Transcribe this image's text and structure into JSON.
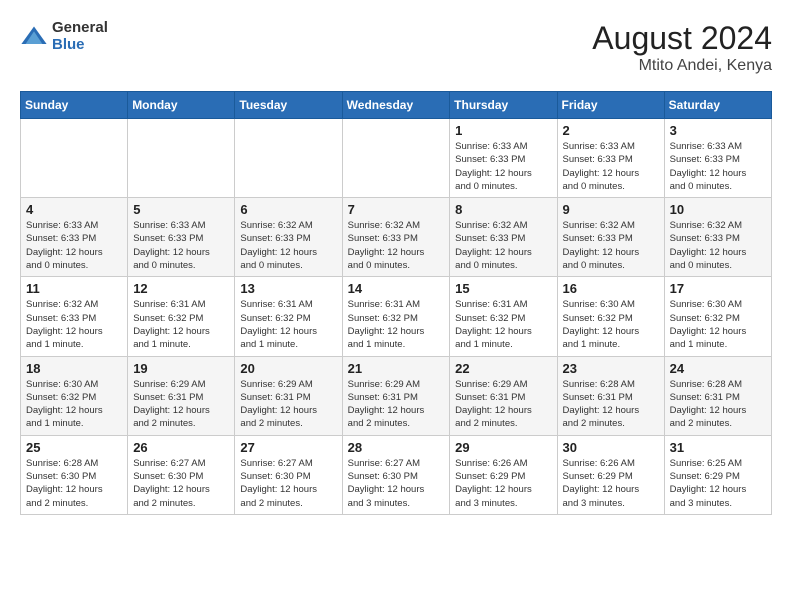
{
  "logo": {
    "general": "General",
    "blue": "Blue"
  },
  "title": {
    "month_year": "August 2024",
    "location": "Mtito Andei, Kenya"
  },
  "weekdays": [
    "Sunday",
    "Monday",
    "Tuesday",
    "Wednesday",
    "Thursday",
    "Friday",
    "Saturday"
  ],
  "weeks": [
    [
      {
        "day": "",
        "info": ""
      },
      {
        "day": "",
        "info": ""
      },
      {
        "day": "",
        "info": ""
      },
      {
        "day": "",
        "info": ""
      },
      {
        "day": "1",
        "info": "Sunrise: 6:33 AM\nSunset: 6:33 PM\nDaylight: 12 hours\nand 0 minutes."
      },
      {
        "day": "2",
        "info": "Sunrise: 6:33 AM\nSunset: 6:33 PM\nDaylight: 12 hours\nand 0 minutes."
      },
      {
        "day": "3",
        "info": "Sunrise: 6:33 AM\nSunset: 6:33 PM\nDaylight: 12 hours\nand 0 minutes."
      }
    ],
    [
      {
        "day": "4",
        "info": "Sunrise: 6:33 AM\nSunset: 6:33 PM\nDaylight: 12 hours\nand 0 minutes."
      },
      {
        "day": "5",
        "info": "Sunrise: 6:33 AM\nSunset: 6:33 PM\nDaylight: 12 hours\nand 0 minutes."
      },
      {
        "day": "6",
        "info": "Sunrise: 6:32 AM\nSunset: 6:33 PM\nDaylight: 12 hours\nand 0 minutes."
      },
      {
        "day": "7",
        "info": "Sunrise: 6:32 AM\nSunset: 6:33 PM\nDaylight: 12 hours\nand 0 minutes."
      },
      {
        "day": "8",
        "info": "Sunrise: 6:32 AM\nSunset: 6:33 PM\nDaylight: 12 hours\nand 0 minutes."
      },
      {
        "day": "9",
        "info": "Sunrise: 6:32 AM\nSunset: 6:33 PM\nDaylight: 12 hours\nand 0 minutes."
      },
      {
        "day": "10",
        "info": "Sunrise: 6:32 AM\nSunset: 6:33 PM\nDaylight: 12 hours\nand 0 minutes."
      }
    ],
    [
      {
        "day": "11",
        "info": "Sunrise: 6:32 AM\nSunset: 6:33 PM\nDaylight: 12 hours\nand 1 minute."
      },
      {
        "day": "12",
        "info": "Sunrise: 6:31 AM\nSunset: 6:32 PM\nDaylight: 12 hours\nand 1 minute."
      },
      {
        "day": "13",
        "info": "Sunrise: 6:31 AM\nSunset: 6:32 PM\nDaylight: 12 hours\nand 1 minute."
      },
      {
        "day": "14",
        "info": "Sunrise: 6:31 AM\nSunset: 6:32 PM\nDaylight: 12 hours\nand 1 minute."
      },
      {
        "day": "15",
        "info": "Sunrise: 6:31 AM\nSunset: 6:32 PM\nDaylight: 12 hours\nand 1 minute."
      },
      {
        "day": "16",
        "info": "Sunrise: 6:30 AM\nSunset: 6:32 PM\nDaylight: 12 hours\nand 1 minute."
      },
      {
        "day": "17",
        "info": "Sunrise: 6:30 AM\nSunset: 6:32 PM\nDaylight: 12 hours\nand 1 minute."
      }
    ],
    [
      {
        "day": "18",
        "info": "Sunrise: 6:30 AM\nSunset: 6:32 PM\nDaylight: 12 hours\nand 1 minute."
      },
      {
        "day": "19",
        "info": "Sunrise: 6:29 AM\nSunset: 6:31 PM\nDaylight: 12 hours\nand 2 minutes."
      },
      {
        "day": "20",
        "info": "Sunrise: 6:29 AM\nSunset: 6:31 PM\nDaylight: 12 hours\nand 2 minutes."
      },
      {
        "day": "21",
        "info": "Sunrise: 6:29 AM\nSunset: 6:31 PM\nDaylight: 12 hours\nand 2 minutes."
      },
      {
        "day": "22",
        "info": "Sunrise: 6:29 AM\nSunset: 6:31 PM\nDaylight: 12 hours\nand 2 minutes."
      },
      {
        "day": "23",
        "info": "Sunrise: 6:28 AM\nSunset: 6:31 PM\nDaylight: 12 hours\nand 2 minutes."
      },
      {
        "day": "24",
        "info": "Sunrise: 6:28 AM\nSunset: 6:31 PM\nDaylight: 12 hours\nand 2 minutes."
      }
    ],
    [
      {
        "day": "25",
        "info": "Sunrise: 6:28 AM\nSunset: 6:30 PM\nDaylight: 12 hours\nand 2 minutes."
      },
      {
        "day": "26",
        "info": "Sunrise: 6:27 AM\nSunset: 6:30 PM\nDaylight: 12 hours\nand 2 minutes."
      },
      {
        "day": "27",
        "info": "Sunrise: 6:27 AM\nSunset: 6:30 PM\nDaylight: 12 hours\nand 2 minutes."
      },
      {
        "day": "28",
        "info": "Sunrise: 6:27 AM\nSunset: 6:30 PM\nDaylight: 12 hours\nand 3 minutes."
      },
      {
        "day": "29",
        "info": "Sunrise: 6:26 AM\nSunset: 6:29 PM\nDaylight: 12 hours\nand 3 minutes."
      },
      {
        "day": "30",
        "info": "Sunrise: 6:26 AM\nSunset: 6:29 PM\nDaylight: 12 hours\nand 3 minutes."
      },
      {
        "day": "31",
        "info": "Sunrise: 6:25 AM\nSunset: 6:29 PM\nDaylight: 12 hours\nand 3 minutes."
      }
    ]
  ]
}
